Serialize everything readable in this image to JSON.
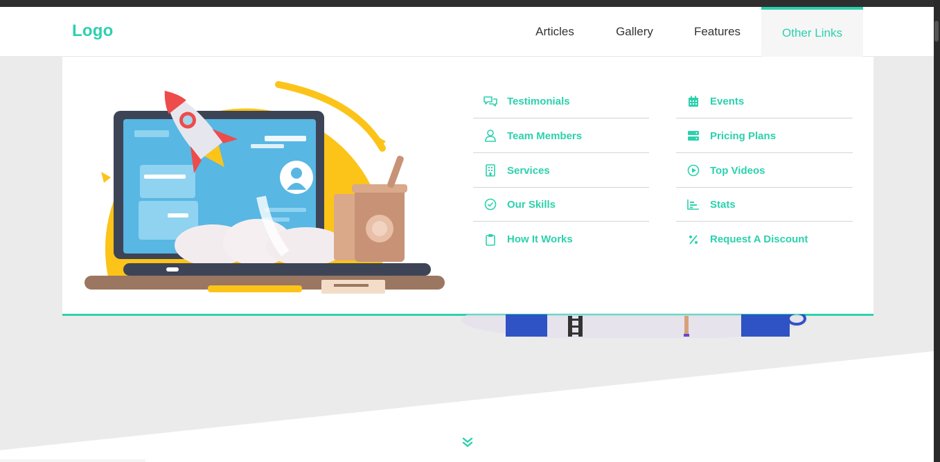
{
  "header": {
    "logo": "Logo",
    "nav": [
      {
        "label": "Articles"
      },
      {
        "label": "Gallery"
      },
      {
        "label": "Features"
      },
      {
        "label": "Other Links"
      }
    ]
  },
  "mega_menu": {
    "left_column": [
      {
        "label": "Testimonials",
        "icon": "chat-bubbles-icon"
      },
      {
        "label": "Team Members",
        "icon": "user-icon"
      },
      {
        "label": "Services",
        "icon": "building-icon"
      },
      {
        "label": "Our Skills",
        "icon": "check-circle-icon"
      },
      {
        "label": "How It Works",
        "icon": "clipboard-icon"
      }
    ],
    "right_column": [
      {
        "label": "Events",
        "icon": "calendar-icon"
      },
      {
        "label": "Pricing Plans",
        "icon": "server-icon"
      },
      {
        "label": "Top Videos",
        "icon": "play-circle-icon"
      },
      {
        "label": "Stats",
        "icon": "bar-chart-icon"
      },
      {
        "label": "Request A Discount",
        "icon": "percent-icon"
      }
    ]
  },
  "colors": {
    "accent": "#2bd1ad",
    "nav_text": "#333333",
    "background": "#ebebeb"
  }
}
